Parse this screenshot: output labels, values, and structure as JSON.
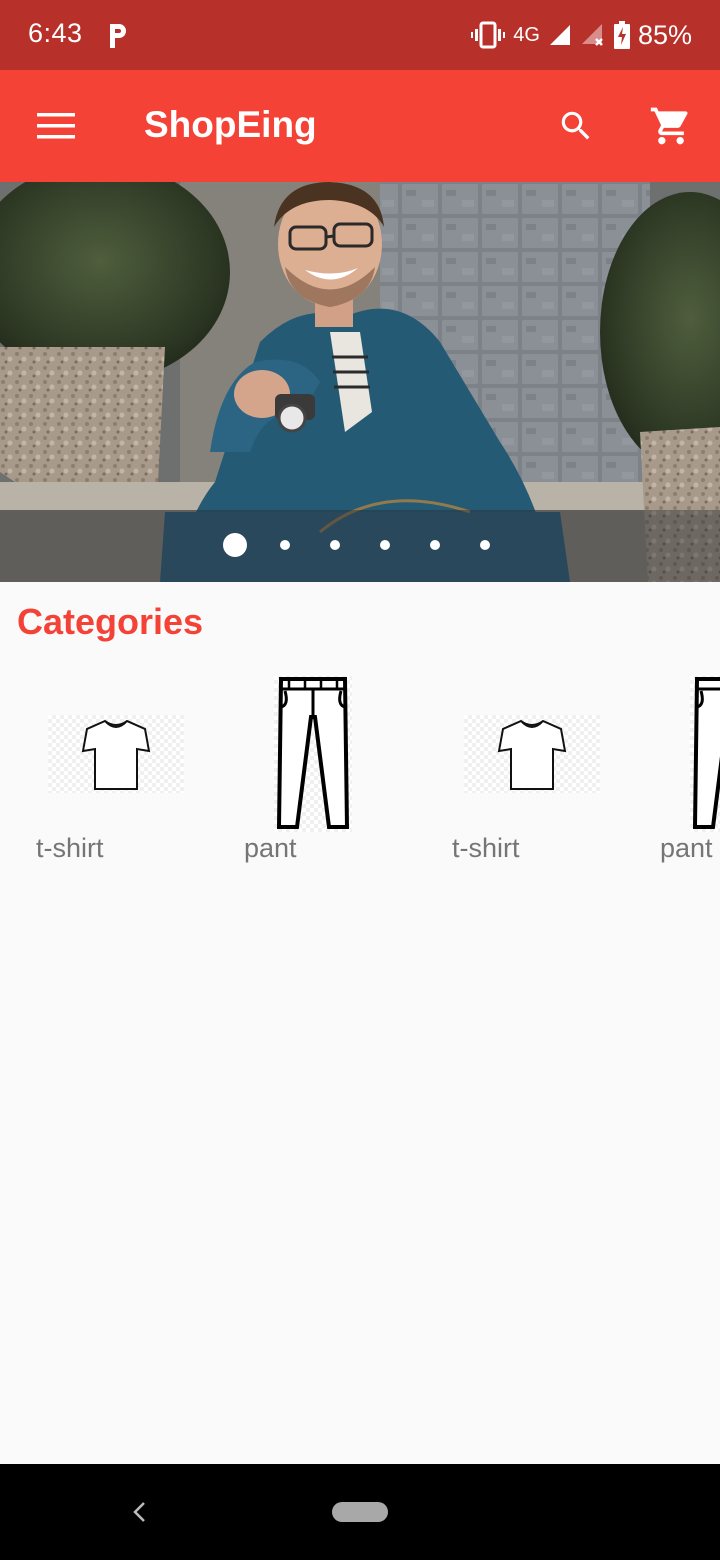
{
  "status_bar": {
    "time": "6:43",
    "network": "4G",
    "battery": "85%",
    "icons": [
      "parking-p-icon",
      "vibrate-icon",
      "signal-icon",
      "signal-off-icon",
      "battery-charging-icon"
    ]
  },
  "app_bar": {
    "title": "ShopEing",
    "menu_icon": "menu-icon",
    "search_icon": "search-icon",
    "cart_icon": "shopping-cart-icon",
    "color": "#f44336"
  },
  "carousel": {
    "slide_count": 6,
    "active_index": 0
  },
  "categories": {
    "heading": "Categories",
    "items": [
      {
        "label": "t-shirt",
        "icon": "tshirt-icon"
      },
      {
        "label": "pant",
        "icon": "pants-icon"
      },
      {
        "label": "t-shirt",
        "icon": "tshirt-icon"
      },
      {
        "label": "pant",
        "icon": "pants-icon"
      }
    ]
  },
  "nav_bar": {
    "back_icon": "back-icon",
    "home_icon": "home-pill-icon"
  },
  "colors": {
    "accent": "#f44336",
    "status_bar": "#b8302a",
    "label": "#757575"
  }
}
